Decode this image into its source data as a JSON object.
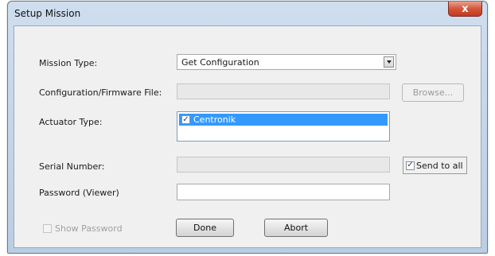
{
  "window": {
    "title": "Setup Mission",
    "close_glyph": "x"
  },
  "form": {
    "mission_type_label": "Mission Type:",
    "mission_type_value": "Get Configuration",
    "config_file_label": "Configuration/Firmware File:",
    "config_file_value": "",
    "browse_label": "Browse...",
    "actuator_type_label": "Actuator Type:",
    "actuator_items": [
      {
        "label": "Centronik",
        "checked": true,
        "selected": true
      }
    ],
    "serial_number_label": "Serial Number:",
    "serial_number_value": "",
    "send_to_all_label": "Send to all",
    "send_to_all_checked": true,
    "password_label": "Password (Viewer)",
    "password_value": "",
    "show_password_label": "Show Password",
    "show_password_checked": false
  },
  "buttons": {
    "done_label": "Done",
    "abort_label": "Abort"
  },
  "icons": {
    "close": "close-icon",
    "dropdown": "chevron-down-icon",
    "check": "checkmark-icon"
  },
  "colors": {
    "close_button": "#c94a2f",
    "selection": "#3399ff",
    "titlebar": "#c4d6eb"
  }
}
